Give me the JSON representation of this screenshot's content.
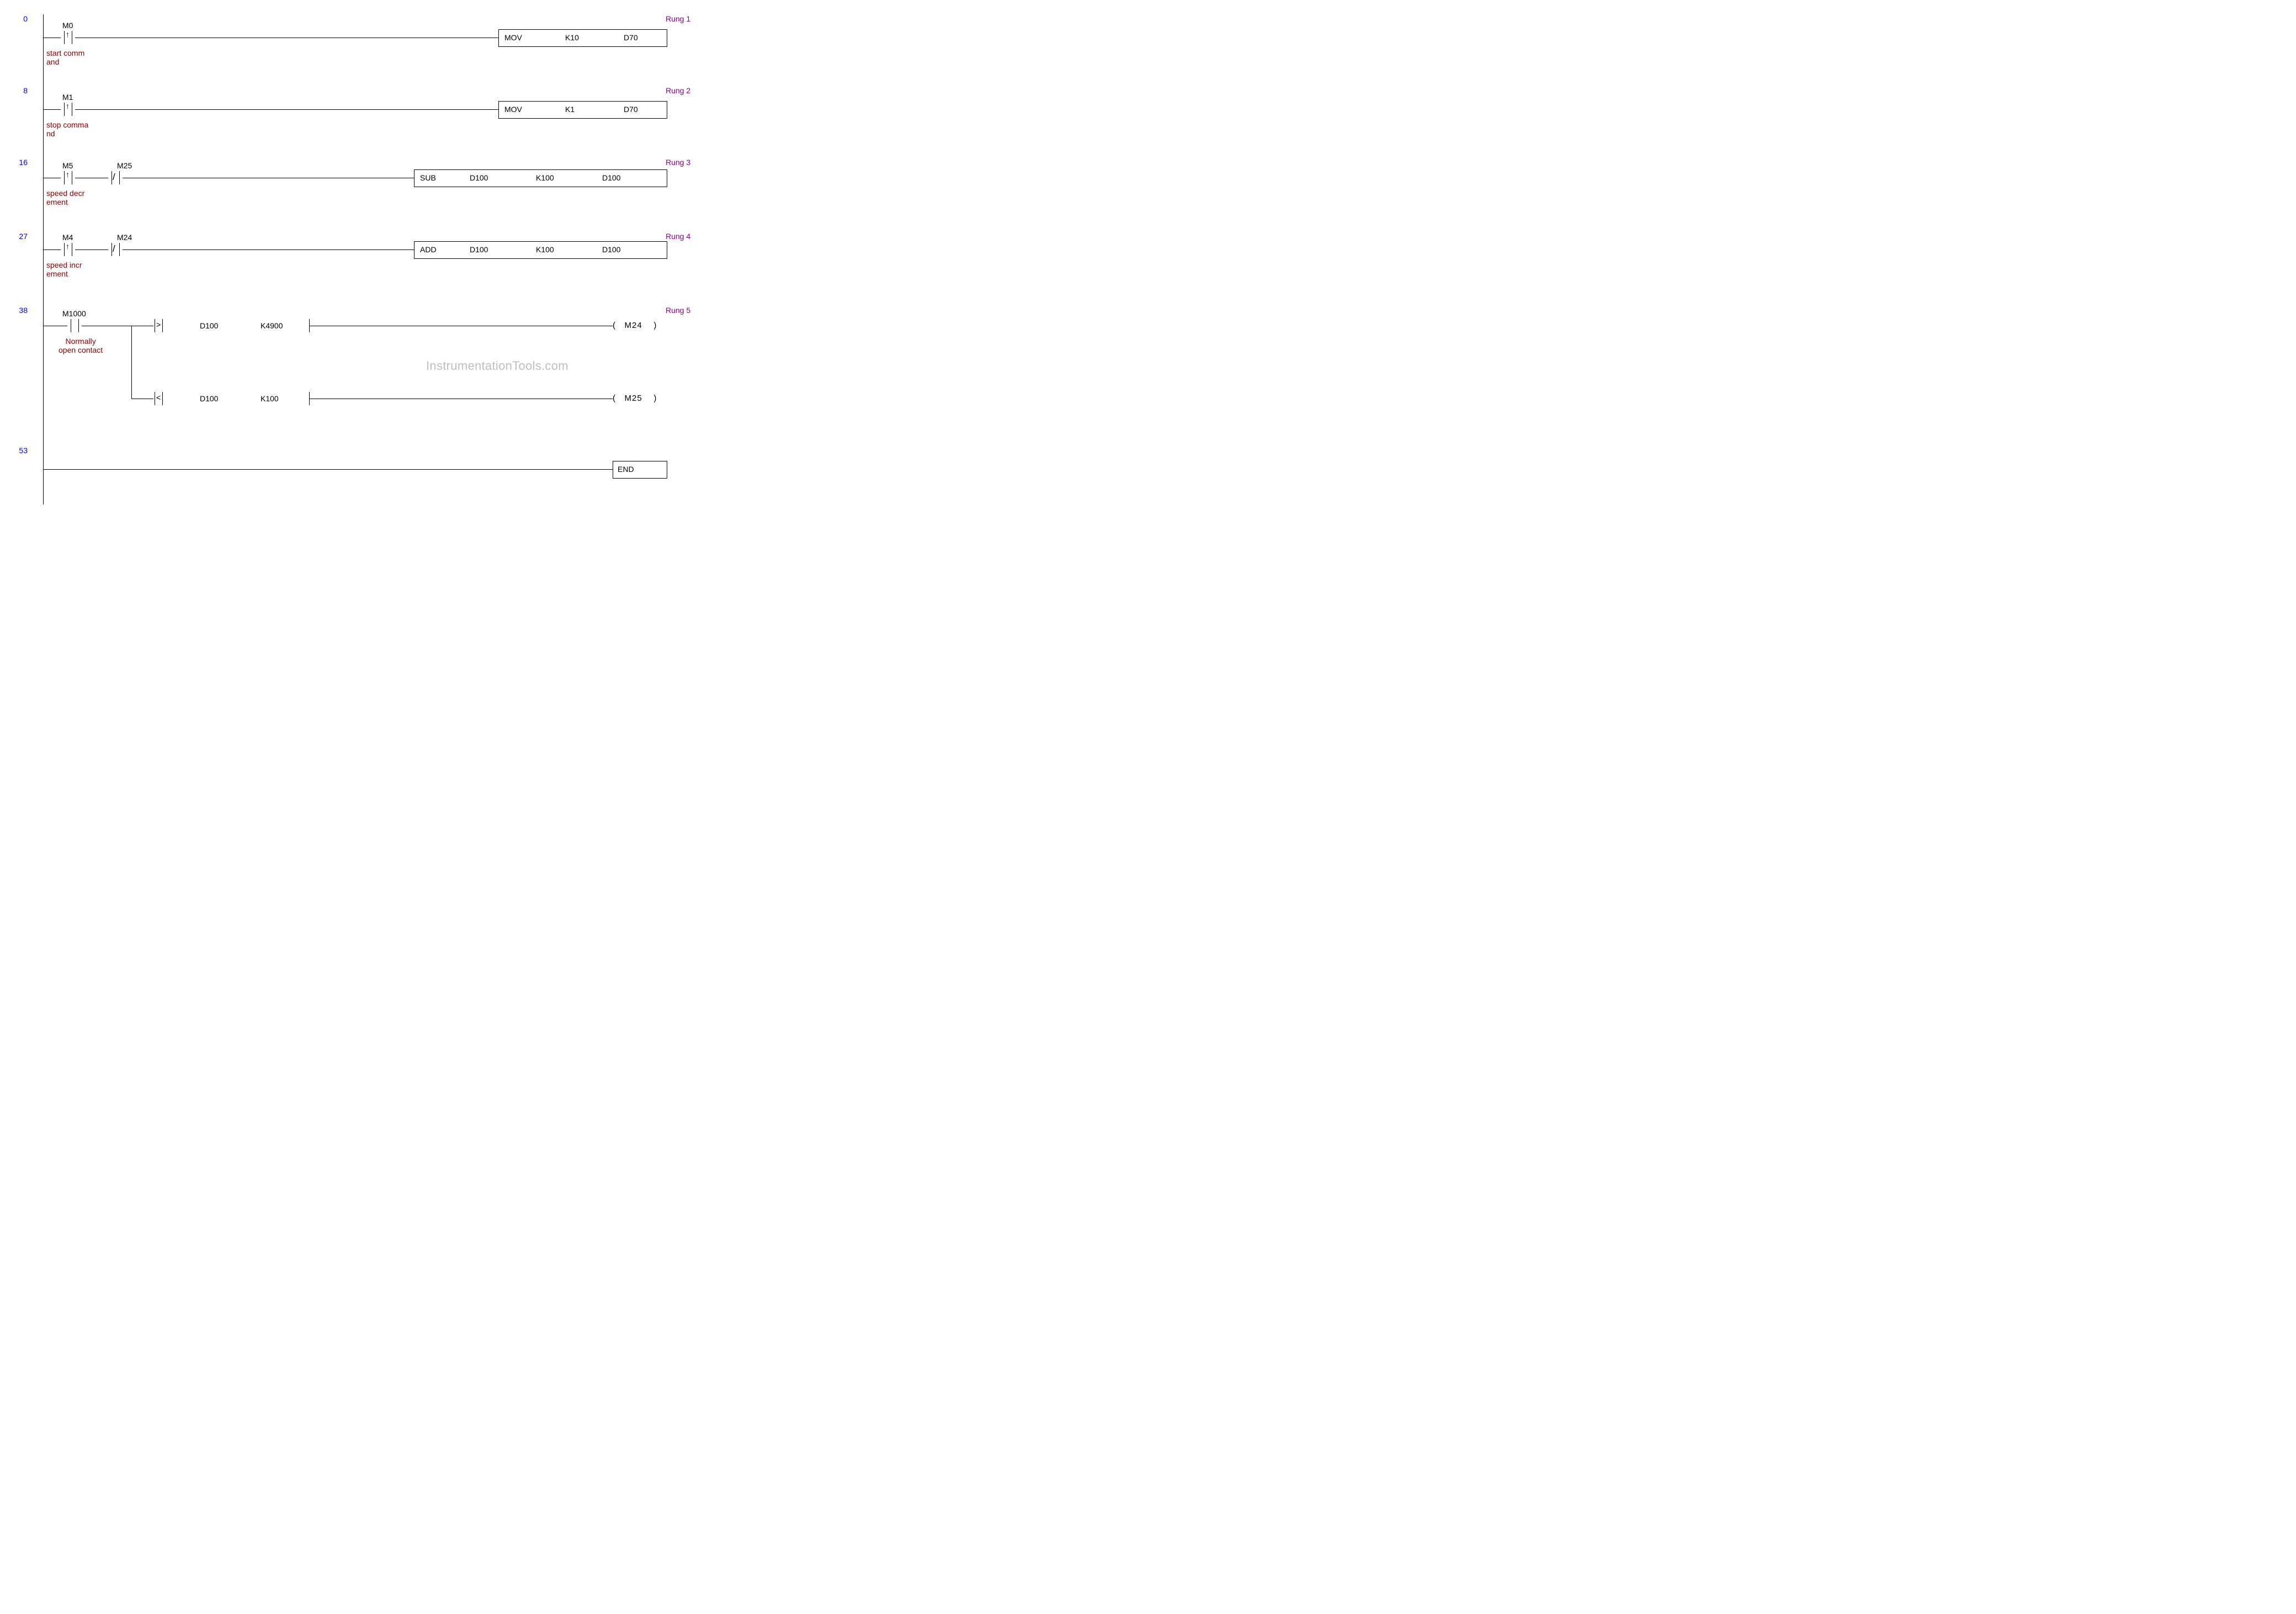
{
  "steps": {
    "r1": "0",
    "r2": "8",
    "r3": "16",
    "r4": "27",
    "r5": "38",
    "r6": "53"
  },
  "rung_labels": {
    "r1": "Rung 1",
    "r2": "Rung 2",
    "r3": "Rung 3",
    "r4": "Rung 4",
    "r5": "Rung 5"
  },
  "r1": {
    "contact_addr": "M0",
    "contact_comment_l1": "start comm",
    "contact_comment_l2": "and",
    "box_op": "MOV",
    "box_src": "K10",
    "box_dst": "D70"
  },
  "r2": {
    "contact_addr": "M1",
    "contact_comment_l1": "stop comma",
    "contact_comment_l2": "nd",
    "box_op": "MOV",
    "box_src": "K1",
    "box_dst": "D70"
  },
  "r3": {
    "c1_addr": "M5",
    "c2_addr": "M25",
    "c1_comment_l1": "speed decr",
    "c1_comment_l2": "ement",
    "box_op": "SUB",
    "box_a": "D100",
    "box_b": "K100",
    "box_c": "D100"
  },
  "r4": {
    "c1_addr": "M4",
    "c2_addr": "M24",
    "c1_comment_l1": "speed incr",
    "c1_comment_l2": "ement",
    "box_op": "ADD",
    "box_a": "D100",
    "box_b": "K100",
    "box_c": "D100"
  },
  "r5": {
    "c1_addr": "M1000",
    "c1_comment_l1": "Normally",
    "c1_comment_l2": "open contact",
    "cmp1_op": ">",
    "cmp1_a": "D100",
    "cmp1_b": "K4900",
    "coil1": "M24",
    "cmp2_op": "<",
    "cmp2_a": "D100",
    "cmp2_b": "K100",
    "coil2": "M25"
  },
  "r6": {
    "box_op": "END"
  },
  "watermark": "InstrumentationTools.com"
}
